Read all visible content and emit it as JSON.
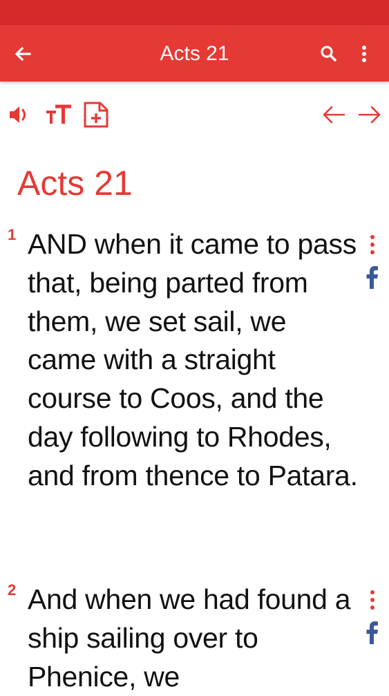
{
  "app_bar": {
    "title": "Acts 21",
    "back_icon": "arrow-back-icon",
    "search_icon": "search-icon",
    "more_icon": "more-vert-icon",
    "color": "#e53935",
    "status_color": "#d52a2a"
  },
  "toolbar": {
    "items": [
      "speaker-icon",
      "text-size-icon",
      "add-note-icon",
      "arrow-left-icon",
      "arrow-right-icon"
    ]
  },
  "chapter": {
    "title": "Acts 21",
    "verses": [
      {
        "number": "1",
        "text": "AND when it came to pass that, being parted from them, we set sail, we came with a straight course to Coos, and the day following to Rhodes, and from thence to Patara."
      },
      {
        "number": "2",
        "text": "And when we had found a ship sailing over to Phenice, we"
      }
    ]
  },
  "colors": {
    "accent": "#e53935",
    "facebook": "#3b5998",
    "text": "#111111"
  }
}
